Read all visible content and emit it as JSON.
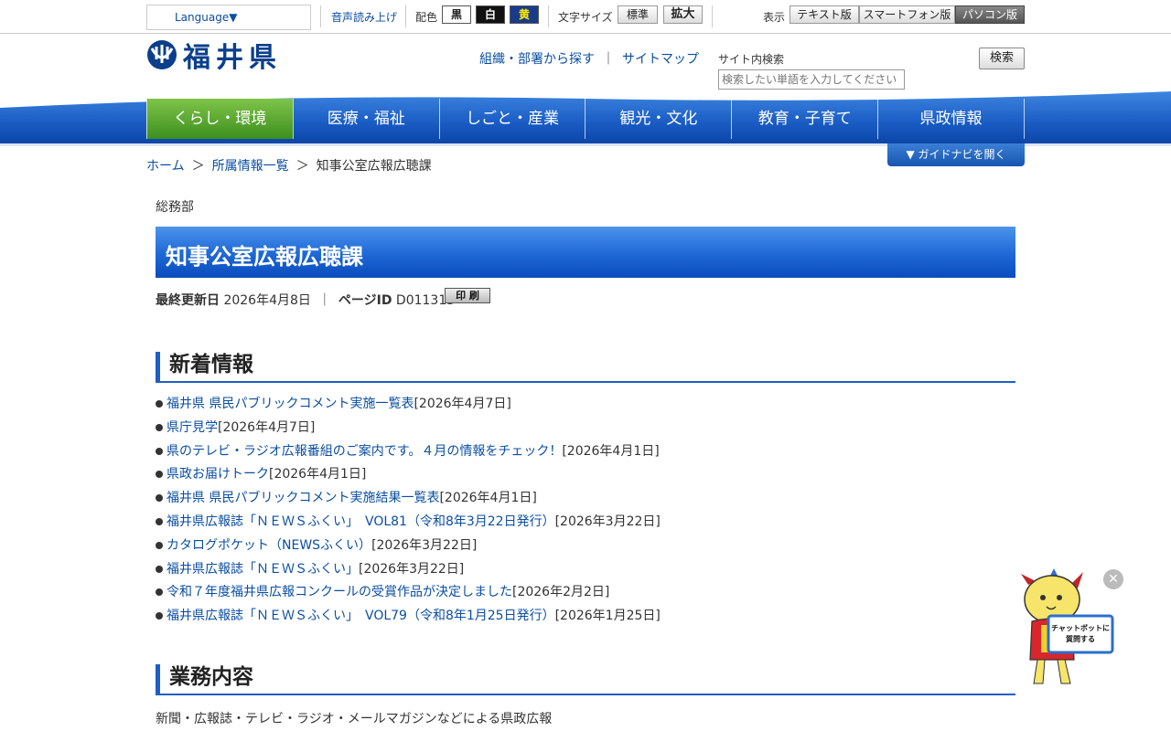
{
  "util": {
    "language": "Language▼",
    "voice": "音声読み上げ",
    "color_label": "配色",
    "color_black": "黒",
    "color_white": "白",
    "color_yellow": "黄",
    "font_label": "文字サイズ",
    "font_standard": "標準",
    "font_large": "拡大",
    "display_label": "表示",
    "display_text": "テキスト版",
    "display_phone": "スマートフォン版",
    "display_pc": "パソコン版"
  },
  "header": {
    "logo_text": "福井県",
    "link_org": "組織・部署から探す",
    "link_sep": "｜",
    "link_sitemap": "サイトマップ",
    "search_label": "サイト内検索",
    "search_placeholder": "検索したい単語を入力してください",
    "search_button": "検索"
  },
  "nav": {
    "items": [
      "くらし・環境",
      "医療・福祉",
      "しごと・産業",
      "観光・文化",
      "教育・子育て",
      "県政情報"
    ]
  },
  "breadcrumb": {
    "home": "ホーム",
    "gt1": "＞",
    "list": "所属情報一覧",
    "gt2": "＞",
    "current": "知事公室広報広聴課"
  },
  "guide_button": "▼ ガイドナビを開く",
  "main": {
    "dept": "総務部",
    "title": "知事公室広報広聴課",
    "updated_label": "最終更新日",
    "updated_value": "2026年4月8日",
    "meta_sep": "｜",
    "page_id_label": "ページID",
    "page_id_value": "D011315",
    "print_button": "印 刷",
    "news_heading": "新着情報",
    "news": [
      {
        "title": "福井県 県民パブリックコメント実施一覧表",
        "date": "[2026年4月7日]"
      },
      {
        "title": "県庁見学",
        "date": "[2026年4月7日]"
      },
      {
        "title": "県のテレビ・ラジオ広報番組のご案内です。４月の情報をチェック！",
        "date": "[2026年4月1日]"
      },
      {
        "title": "県政お届けトーク",
        "date": "[2026年4月1日]"
      },
      {
        "title": "福井県 県民パブリックコメント実施結果一覧表",
        "date": "[2026年4月1日]"
      },
      {
        "title": "福井県広報誌「ＮＥＷＳふくい」　VOL81（令和8年3月22日発行）",
        "date": "[2026年3月22日]"
      },
      {
        "title": "カタログポケット（NEWSふくい）",
        "date": "[2026年3月22日]"
      },
      {
        "title": "福井県広報誌「ＮＥＷＳふくい」",
        "date": "[2026年3月22日]"
      },
      {
        "title": "令和７年度福井県広報コンクールの受賞作品が決定しました",
        "date": "[2026年2月2日]"
      },
      {
        "title": "福井県広報誌「ＮＥＷＳふくい」　VOL79（令和8年1月25日発行）",
        "date": "[2026年1月25日]"
      }
    ],
    "work_heading": "業務内容",
    "work_text": "新聞・広報誌・テレビ・ラジオ・メールマガジンなどによる県政広報"
  },
  "chatbot": {
    "close": "✕",
    "bubble_line1": "チャットボットに",
    "bubble_line2": "質問する"
  }
}
